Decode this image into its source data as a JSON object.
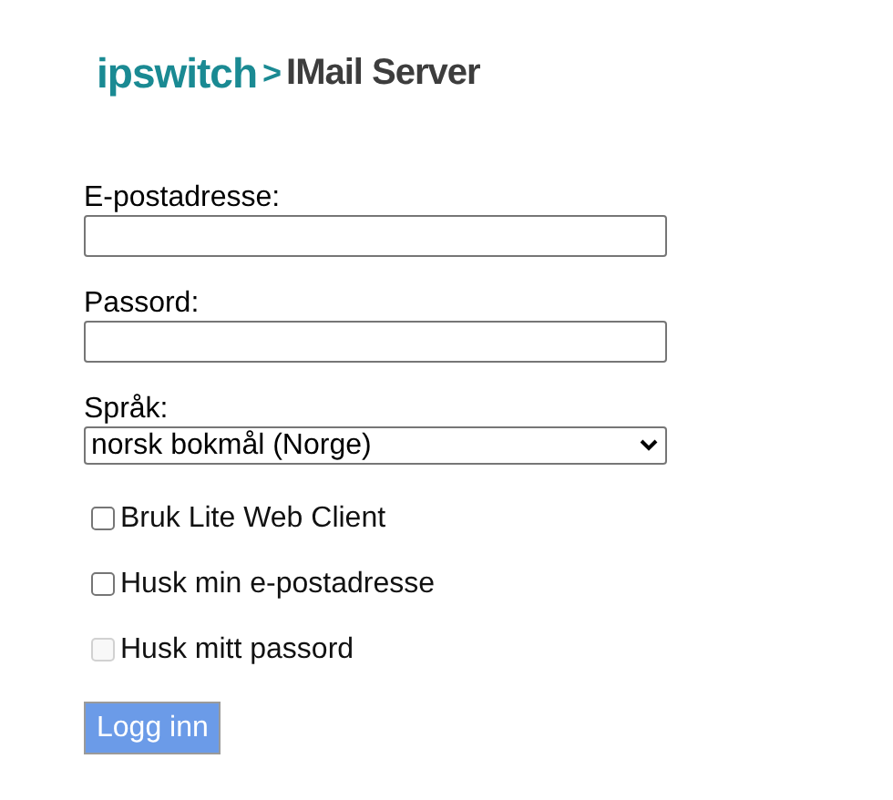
{
  "logo": {
    "brand": "ipswitch",
    "separator": ">",
    "product": "IMail Server"
  },
  "fields": [
    {
      "label": "E-postadresse:",
      "kind": "text"
    },
    {
      "label": "Passord:",
      "kind": "password"
    },
    {
      "label": "Språk:",
      "kind": "select",
      "value": "norsk bokmål (Norge)"
    }
  ],
  "options": [
    {
      "label": "Bruk Lite Web Client",
      "checked": false,
      "disabled": false
    },
    {
      "label": "Husk min e-postadresse",
      "checked": false,
      "disabled": false
    },
    {
      "label": "Husk mitt passord",
      "checked": false,
      "disabled": true
    }
  ],
  "login_button": "Logg inn"
}
